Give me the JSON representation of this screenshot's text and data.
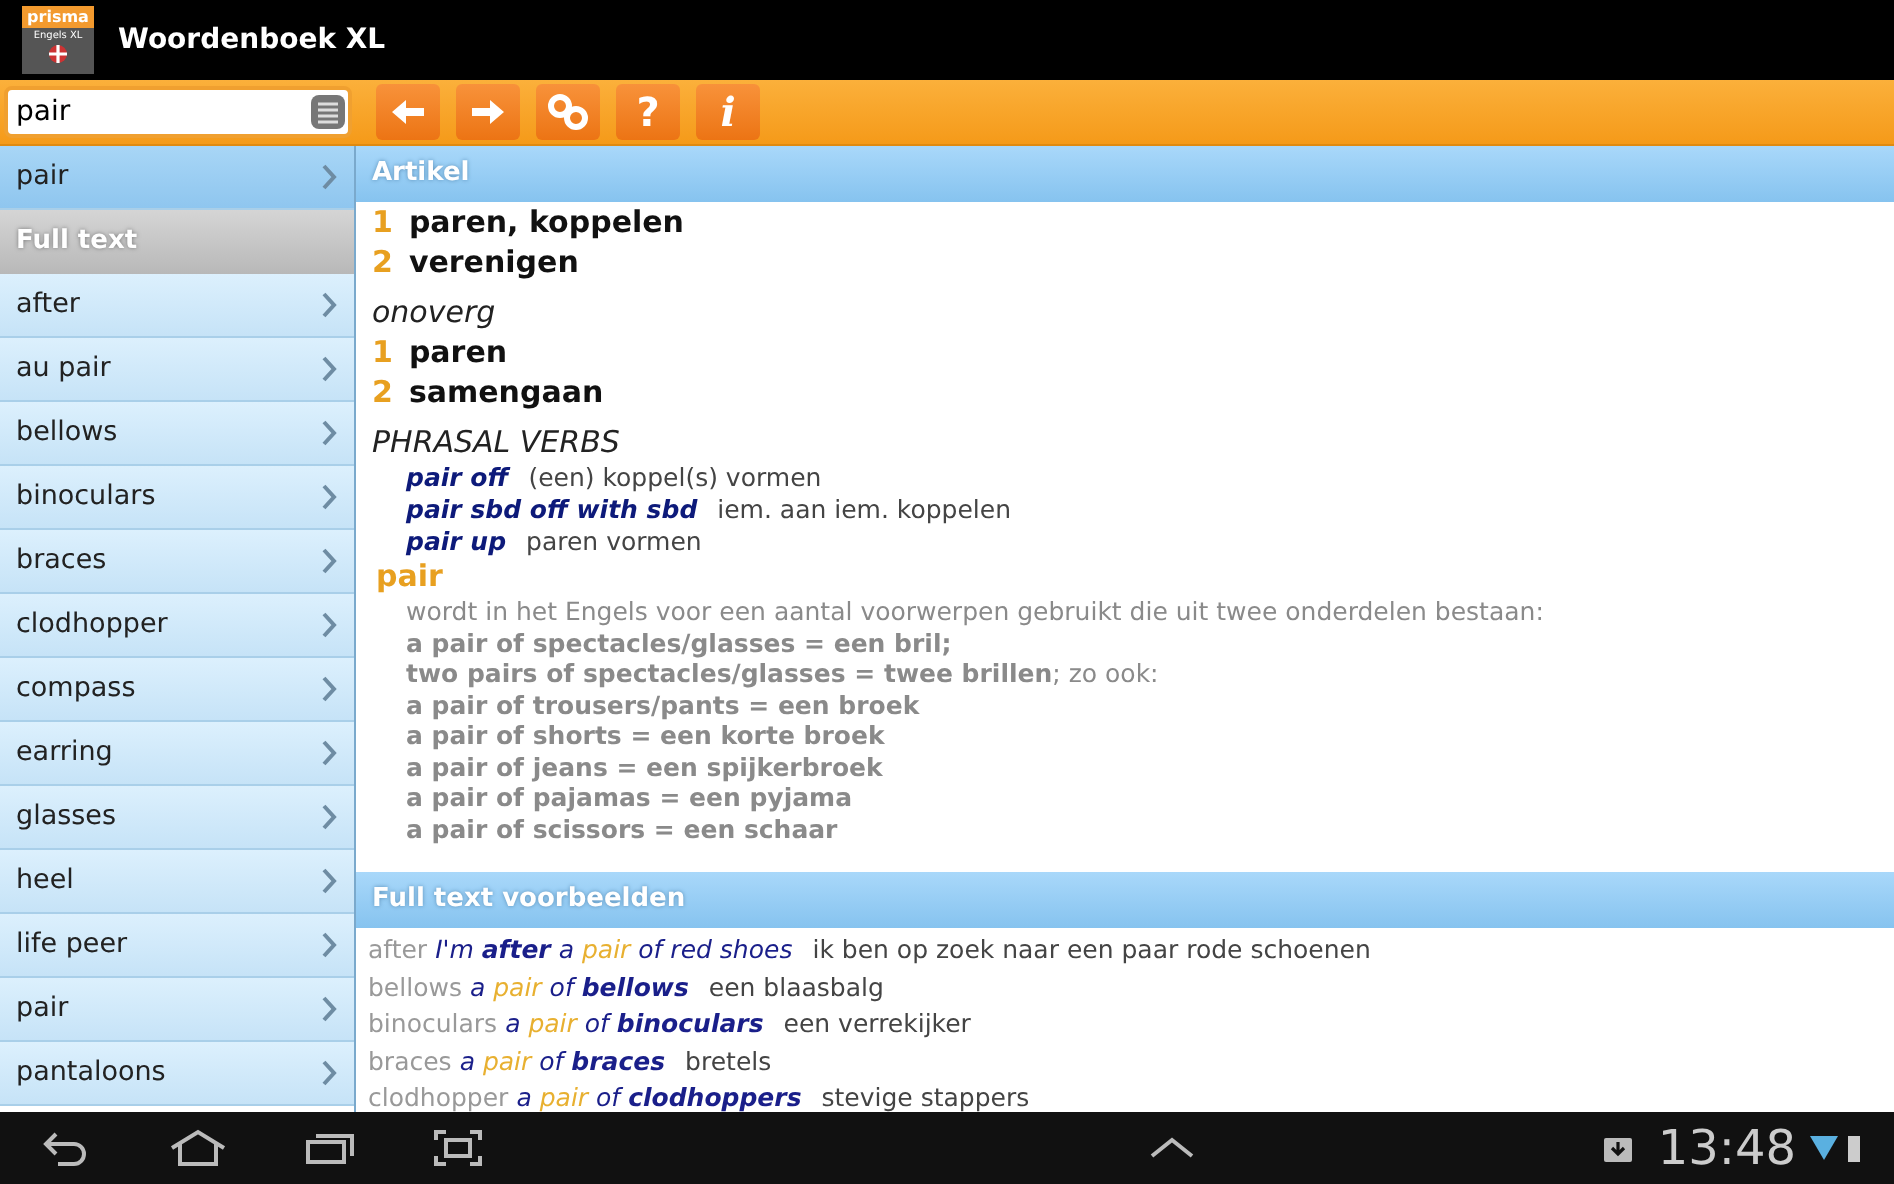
{
  "app": {
    "brand": "prisma",
    "subtitle": "Engels XL",
    "title": "Woordenboek XL"
  },
  "search": {
    "value": "pair"
  },
  "toolbar": [
    {
      "kind": "back"
    },
    {
      "kind": "forward"
    },
    {
      "kind": "link"
    },
    {
      "kind": "help",
      "label": "?"
    },
    {
      "kind": "info",
      "label": "i"
    }
  ],
  "sidebar": {
    "entry": {
      "label": "pair",
      "selected": true
    },
    "section": "Full text",
    "items": [
      "after",
      "au pair",
      "bellows",
      "binoculars",
      "braces",
      "clodhopper",
      "compass",
      "earring",
      "glasses",
      "heel",
      "life peer",
      "pair",
      "pantaloons"
    ]
  },
  "article": {
    "title": "Artikel",
    "lines": [
      {
        "kind": "sense",
        "number": "1",
        "text": "paren, koppelen"
      },
      {
        "kind": "sense",
        "number": "2",
        "text": "verenigen"
      },
      {
        "kind": "label",
        "text": "onoverg"
      },
      {
        "kind": "sense",
        "number": "1",
        "text": "paren"
      },
      {
        "kind": "sense",
        "number": "2",
        "text": "samengaan"
      },
      {
        "kind": "label",
        "text": "PHRASAL VERBS"
      },
      {
        "kind": "phrasal",
        "phrase": "pair off",
        "translation": "(een) koppel(s) vormen"
      },
      {
        "kind": "phrasal",
        "phrase": "**pair** sbd **off with** sbd",
        "translation": "iem. aan iem. koppelen"
      },
      {
        "kind": "phrasal",
        "phrase": "pair up",
        "translation": "paren vormen"
      },
      {
        "kind": "headword",
        "text": "pair"
      },
      {
        "kind": "note",
        "text": "wordt in het Engels voor een aantal voorwerpen gebruikt die uit twee onderdelen bestaan:"
      },
      {
        "kind": "example",
        "text": "a pair of spectacles/glasses = een bril;"
      },
      {
        "kind": "note",
        "text": "**two pairs of spectacles/glasses = twee brillen**; zo ook:"
      },
      {
        "kind": "example",
        "text": "a pair of trousers/pants = een broek"
      },
      {
        "kind": "example",
        "text": "a pair of shorts = een korte broek"
      },
      {
        "kind": "example",
        "text": "a pair of jeans = een spijkerbroek"
      },
      {
        "kind": "example",
        "text": "a pair of pajamas = een pyjama"
      },
      {
        "kind": "example",
        "text": "a pair of scissors = een schaar"
      }
    ]
  },
  "examples": {
    "title": "Full text voorbeelden",
    "rows": [
      {
        "word": "after",
        "before": "I'm **after** a ",
        "highlight": "pair",
        "after": " of red shoes",
        "translation": "ik ben op zoek naar een paar rode schoenen"
      },
      {
        "word": "bellows",
        "before": "a ",
        "highlight": "pair",
        "after": " of **bellows**",
        "translation": "een blaasbalg"
      },
      {
        "word": "binoculars",
        "before": "a ",
        "highlight": "pair",
        "after": " of **binoculars**",
        "translation": "een verrekijker"
      },
      {
        "word": "braces",
        "before": "a ",
        "highlight": "pair",
        "after": " of **braces**",
        "translation": "bretels"
      },
      {
        "word": "clodhopper",
        "before": "a ",
        "highlight": "pair",
        "after": " of **clodhoppers**",
        "translation": "stevige stappers"
      }
    ]
  },
  "system_bar": {
    "time": "13:48"
  }
}
